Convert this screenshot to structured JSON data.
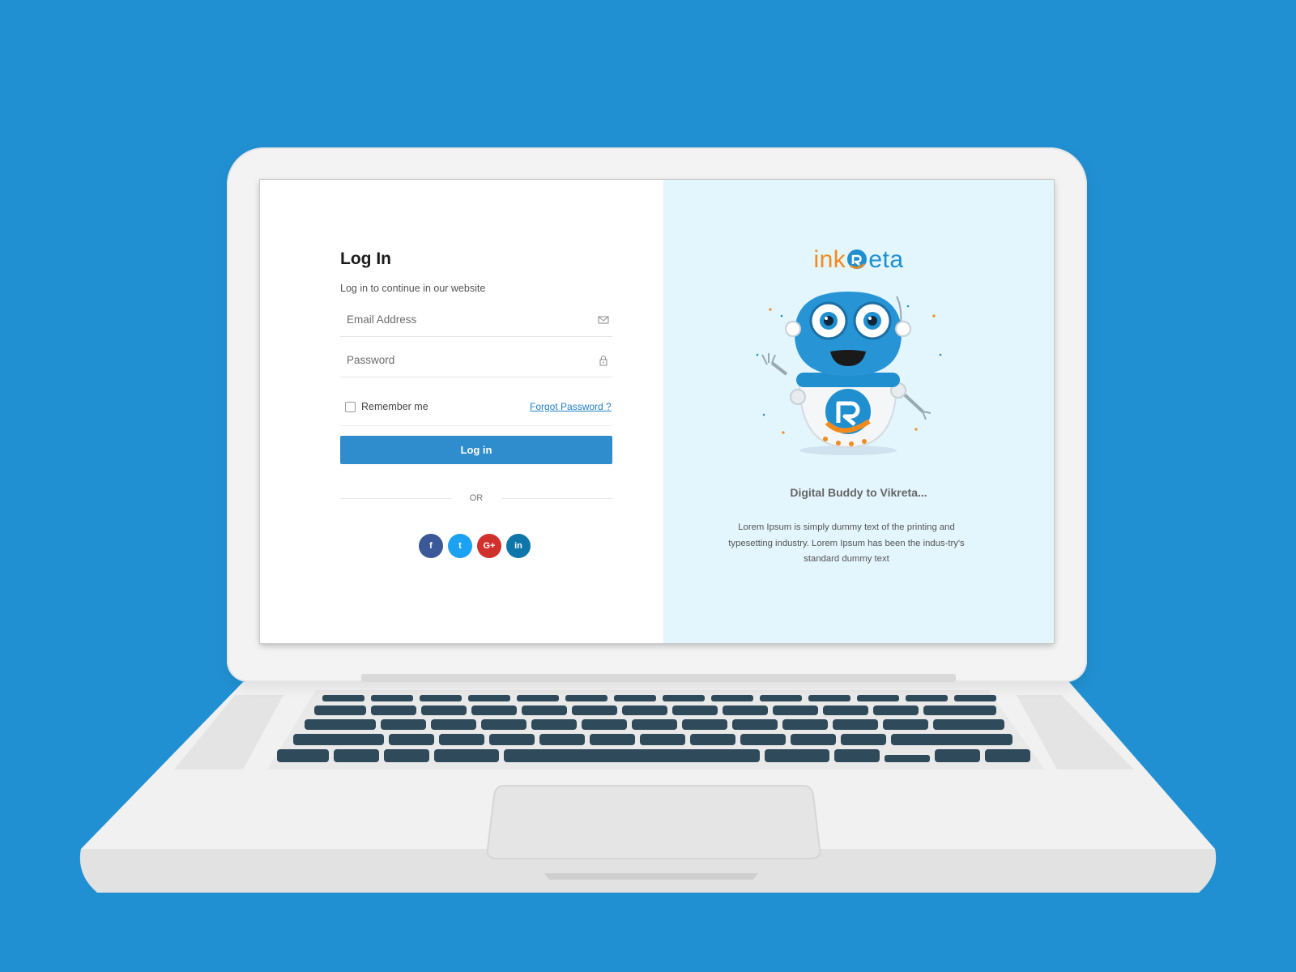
{
  "login": {
    "title": "Log In",
    "subtitle": "Log in to continue in our website",
    "email_placeholder": "Email Address",
    "password_placeholder": "Password",
    "remember_label": "Remember me",
    "forgot_label": "Forgot Password ?",
    "button_label": "Log in",
    "or_label": "OR",
    "social": [
      {
        "name": "facebook-icon",
        "glyph": "f",
        "color": "#3b5998"
      },
      {
        "name": "twitter-icon",
        "glyph": "t",
        "color": "#1da1f2"
      },
      {
        "name": "google-plus-icon",
        "glyph": "G+",
        "color": "#d0312d"
      },
      {
        "name": "linkedin-icon",
        "glyph": "in",
        "color": "#0e76a8"
      }
    ]
  },
  "promo": {
    "brand_prefix": "ink",
    "brand_suffix": "eta",
    "tagline": "Digital Buddy to Vikreta...",
    "description": "Lorem Ipsum is simply dummy text of the printing and typesetting industry. Lorem Ipsum has been the indus-try's standard dummy text"
  },
  "colors": {
    "background": "#2190d2",
    "primary": "#2f8ccd",
    "accent_orange": "#f28a1c",
    "right_panel_bg": "#e3f5fd"
  }
}
